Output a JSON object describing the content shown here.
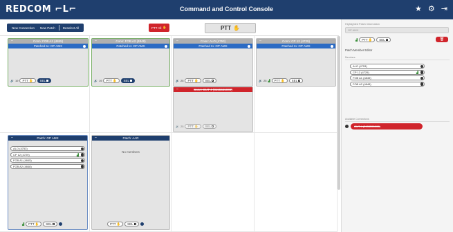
{
  "header": {
    "logo": "REDCOM ⌐L⌐",
    "title": "Command and Control Console",
    "icons": [
      "star-icon",
      "gear-icon",
      "exit-icon"
    ]
  },
  "toolbar": {
    "new_connection": "New Connection",
    "new_patch": "New Patch",
    "deselect_all": "Deselect All",
    "ptt_all": "PTT All",
    "ptt_main": "PTT"
  },
  "cards": {
    "fob_a1": {
      "title": "Conn: FOB A1 (4845)",
      "patched": "Patched to: OP AMX",
      "vol": "19",
      "ptt": "PTT",
      "sel": "SEL"
    },
    "fob_a2": {
      "title": "Conn: FOB A2 (4848)",
      "patched": "Patched to: OP AMX",
      "vol": "19",
      "ptt": "PTT",
      "sel": "SEL"
    },
    "alo": {
      "title": "Conn: ALO (4753)",
      "patched": "Patched to: OP AMX",
      "vol": "25",
      "ptt": "PTT",
      "sel": "SEL"
    },
    "cp12": {
      "title": "Conn: CP 12 (4729)",
      "patched": "Patched to: OP AMX",
      "vol": "25",
      "ptt": "PTT",
      "sel": "SEL"
    },
    "out4": {
      "title": "Conn: OUT 4 (3155555000)",
      "vol": "25",
      "ptt": "PTT",
      "sel": "SEL"
    },
    "patch_opamx": {
      "title": "Patch: OP AMX",
      "members": [
        "ALO (4753)",
        "CP 12 (4729)",
        "FOB A1 (4845)",
        "FOB A2 (4848)"
      ],
      "ptt": "PTT",
      "sel": "SEL"
    },
    "patch_aar": {
      "title": "Patch: AAR",
      "empty": "No members",
      "ptt": "PTT",
      "sel": "SEL"
    }
  },
  "panel": {
    "section_title": "Highlighted Patch Information",
    "name_value": "OP AMX",
    "ptt": "PTT",
    "sel": "SEL",
    "editor_label": "Patch Member Editor",
    "members_label": "Members",
    "members": [
      "ALO (4753)",
      "CP 12 (4729)",
      "FOB A1 (4845)",
      "FOB A2 (4848)"
    ],
    "available_label": "Available Connections",
    "available": [
      "OUT 4 (3155555000)"
    ]
  },
  "colors": {
    "navy": "#1f3f6e",
    "blue": "#2b6bc4",
    "red": "#d0242b",
    "green": "#79b067"
  }
}
